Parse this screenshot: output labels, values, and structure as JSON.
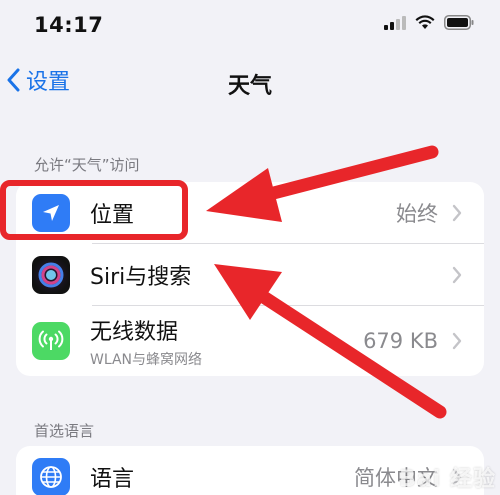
{
  "status_bar": {
    "time": "14:17"
  },
  "nav": {
    "back_label": "设置",
    "title": "天气"
  },
  "access_section": {
    "header": "允许“天气”访问",
    "rows": [
      {
        "label": "位置",
        "value": "始终",
        "icon": "location-arrow-icon"
      },
      {
        "label": "Siri与搜索",
        "value": "",
        "icon": "siri-icon"
      },
      {
        "label": "无线数据",
        "sub": "WLAN与蜂窝网络",
        "value": "679 KB",
        "icon": "antenna-icon"
      }
    ]
  },
  "language_section": {
    "header": "首选语言",
    "rows": [
      {
        "label": "语言",
        "value": "简体中文",
        "icon": "globe-icon"
      }
    ]
  },
  "watermark": "Bai 经验",
  "colors": {
    "accent": "#1a73e8",
    "annotation_red": "#e8262a",
    "location_icon_bg": "#2f7cf6",
    "data_icon_bg": "#4cd964",
    "globe_icon_bg": "#2f7cf6"
  }
}
